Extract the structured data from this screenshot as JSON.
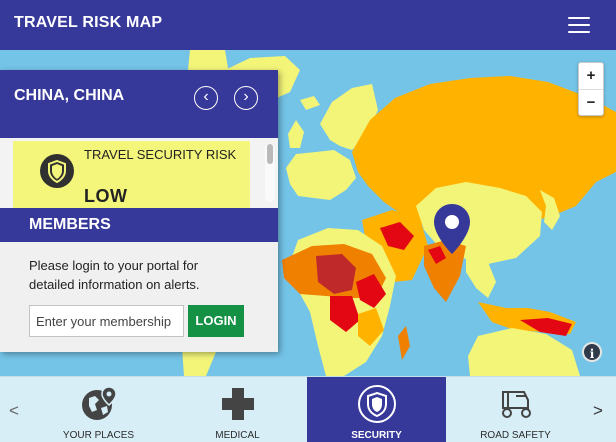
{
  "header": {
    "title": "TRAVEL RISK MAP",
    "menu_icon": "hamburger-menu-icon"
  },
  "map": {
    "zoom_in_label": "+",
    "zoom_out_label": "−",
    "info_label": "i",
    "location_marker_icon": "map-pin-icon",
    "risk_colors": {
      "low": "#f3f579",
      "medium": "#ffb300",
      "high": "#f08000",
      "extreme": "#e30613",
      "insignificant": "#7dc242",
      "water": "#74c4e8"
    }
  },
  "panel": {
    "country": "CHINA, CHINA",
    "prev_label": "‹",
    "next_label": "›",
    "risk": {
      "label": "TRAVEL SECURITY RISK",
      "level": "LOW",
      "icon": "shield-icon",
      "color": "#f4f57b"
    },
    "members": {
      "title": "MEMBERS",
      "text": "Please login to your portal for detailed information on alerts.",
      "placeholder": "Enter your membership",
      "login_label": "LOGIN"
    }
  },
  "bottom_nav": {
    "prev_label": "<",
    "next_label": ">",
    "tabs": [
      {
        "label": "YOUR PLACES",
        "icon": "globe-pin-icon",
        "active": false
      },
      {
        "label": "MEDICAL",
        "icon": "medical-cross-icon",
        "active": false
      },
      {
        "label": "SECURITY",
        "icon": "shield-icon",
        "active": true
      },
      {
        "label": "ROAD SAFETY",
        "icon": "rickshaw-icon",
        "active": false
      }
    ]
  }
}
